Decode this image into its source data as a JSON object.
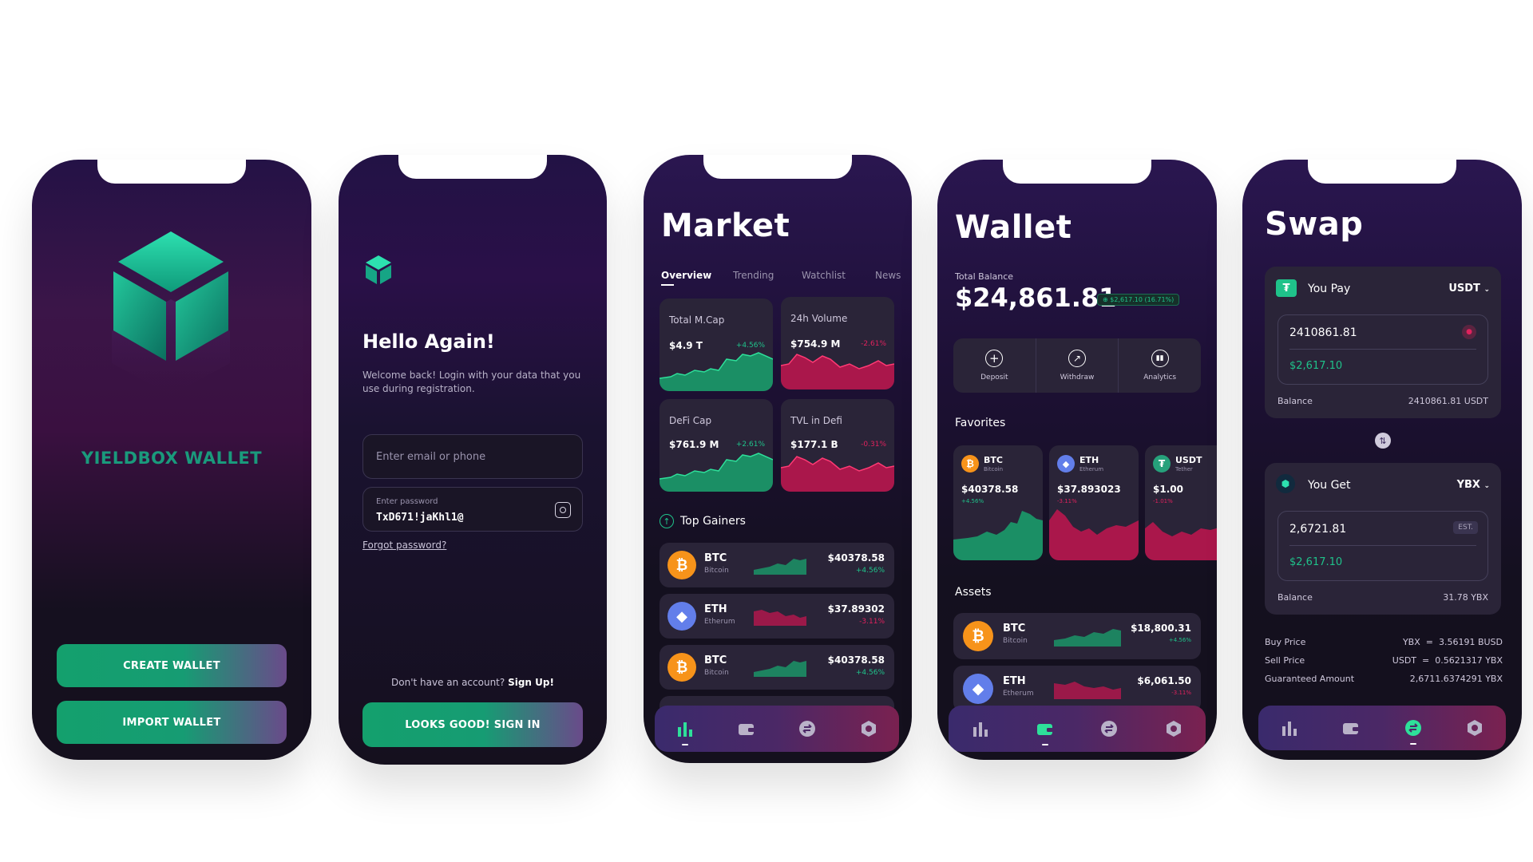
{
  "splash": {
    "brand": "YIELDBOX WALLET",
    "create_btn": "CREATE WALLET",
    "import_btn": "IMPORT WALLET"
  },
  "login": {
    "title": "Hello Again!",
    "subtitle": "Welcome back! Login with your data that you use during registration.",
    "email_placeholder": "Enter email or phone",
    "password_label": "Enter password",
    "password_value": "TxD671!jaKhl1@",
    "forgot": "Forgot password?",
    "no_account": "Don't have an account?",
    "signup": "Sign Up!",
    "signin_btn": "LOOKS GOOD! SIGN IN"
  },
  "market": {
    "title": "Market",
    "tabs": [
      "Overview",
      "Trending",
      "Watchlist",
      "News"
    ],
    "stats": [
      {
        "label": "Total M.Cap",
        "value": "$4.9 T",
        "change": "+4.56%",
        "trend": "up"
      },
      {
        "label": "24h Volume",
        "value": "$754.9 M",
        "change": "-2.61%",
        "trend": "down"
      },
      {
        "label": "DeFi Cap",
        "value": "$761.9 M",
        "change": "+2.61%",
        "trend": "up"
      },
      {
        "label": "TVL in Defi",
        "value": "$177.1 B",
        "change": "-0.31%",
        "trend": "down"
      }
    ],
    "gainers_title": "Top Gainers",
    "gainers": [
      {
        "symbol": "BTC",
        "name": "Bitcoin",
        "price": "$40378.58",
        "change": "+4.56%",
        "trend": "up",
        "coin": "btc"
      },
      {
        "symbol": "ETH",
        "name": "Etherum",
        "price": "$37.89302",
        "change": "-3.11%",
        "trend": "down",
        "coin": "eth"
      },
      {
        "symbol": "BTC",
        "name": "Bitcoin",
        "price": "$40378.58",
        "change": "+4.56%",
        "trend": "up",
        "coin": "btc"
      }
    ]
  },
  "wallet": {
    "title": "Wallet",
    "balance_label": "Total Balance",
    "balance": "$24,861.81",
    "balance_change": "$2,617.10 (16.71%)",
    "actions": [
      "Deposit",
      "Withdraw",
      "Analytics"
    ],
    "favorites_title": "Favorites",
    "favorites": [
      {
        "symbol": "BTC",
        "name": "Bitcoin",
        "price": "$40378.58",
        "change": "+4.56%",
        "trend": "up",
        "coin": "btc"
      },
      {
        "symbol": "ETH",
        "name": "Etherum",
        "price": "$37.893023",
        "change": "-3.11%",
        "trend": "down",
        "coin": "eth"
      },
      {
        "symbol": "USDT",
        "name": "Tether",
        "price": "$1.00",
        "change": "-1.01%",
        "trend": "down",
        "coin": "usdt"
      }
    ],
    "assets_title": "Assets",
    "assets": [
      {
        "symbol": "BTC",
        "name": "Bitcoin",
        "price": "$18,800.31",
        "change": "+4.56%",
        "trend": "up",
        "coin": "btc"
      },
      {
        "symbol": "ETH",
        "name": "Etherum",
        "price": "$6,061.50",
        "change": "-3.11%",
        "trend": "down",
        "coin": "eth"
      }
    ]
  },
  "swap": {
    "title": "Swap",
    "pay": {
      "label": "You Pay",
      "token": "USDT",
      "amount": "2410861.81",
      "usd": "$2,617.10",
      "balance_label": "Balance",
      "balance": "2410861.81 USDT"
    },
    "get": {
      "label": "You Get",
      "token": "YBX",
      "amount": "2,6721.81",
      "est": "EST.",
      "usd": "$2,617.10",
      "balance_label": "Balance",
      "balance": "31.78 YBX"
    },
    "info": [
      {
        "label": "Buy Price",
        "value": "YBX  =  3.56191 BUSD"
      },
      {
        "label": "Sell Price",
        "value": "USDT  =  0.5621317 YBX"
      },
      {
        "label": "Guaranteed Amount",
        "value": "2,6711.6374291 YBX"
      }
    ]
  },
  "icons": [
    "bar-chart-icon",
    "wallet-icon",
    "swap-icon",
    "settings-icon"
  ],
  "colors": {
    "green": "#1fc28a",
    "red": "#e0225d",
    "btc": "#f7931a",
    "eth": "#627eea",
    "usdt": "#26a17b"
  }
}
